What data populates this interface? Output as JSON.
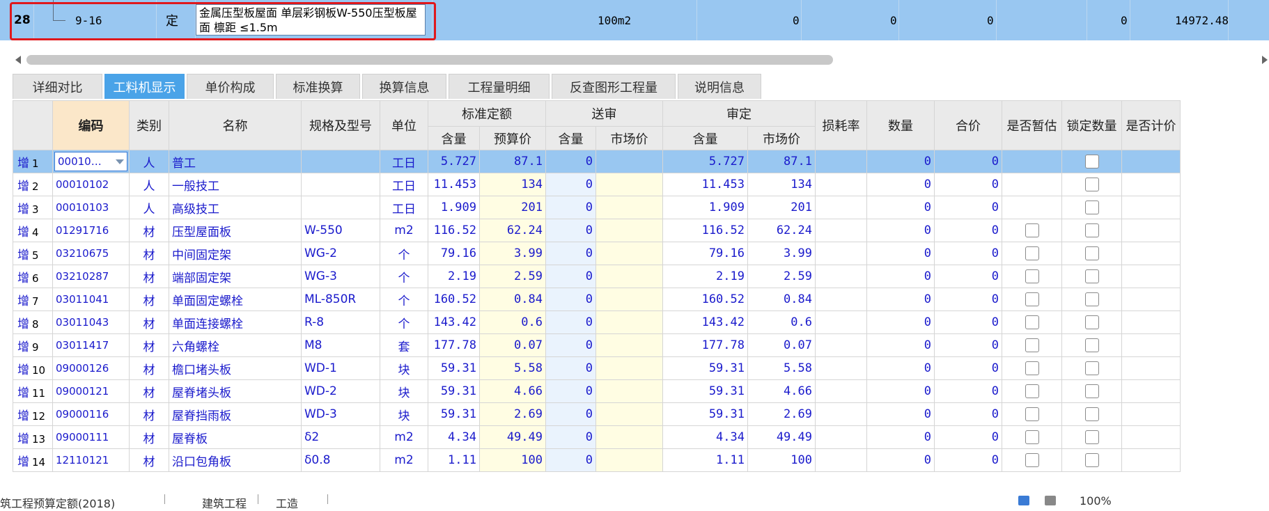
{
  "top_row": {
    "row_number": "28",
    "code": "9-16",
    "type": "定",
    "name": "金属压型板屋面 单层彩钢板W-550压型板屋面 檩距 ≤1.5m",
    "unit": "100m2",
    "v1": "0",
    "v2": "0",
    "v3": "0",
    "v4": "0",
    "total": "14972.48"
  },
  "tabs": [
    {
      "label": "详细对比",
      "active": false
    },
    {
      "label": "工料机显示",
      "active": true
    },
    {
      "label": "单价构成",
      "active": false
    },
    {
      "label": "标准换算",
      "active": false
    },
    {
      "label": "换算信息",
      "active": false
    },
    {
      "label": "工程量明细",
      "active": false
    },
    {
      "label": "反查图形工程量",
      "active": false
    },
    {
      "label": "说明信息",
      "active": false
    }
  ],
  "headers": {
    "code": "编码",
    "category": "类别",
    "name": "名称",
    "spec": "规格及型号",
    "unit": "单位",
    "std_quota": "标准定额",
    "submit": "送审",
    "approve": "审定",
    "sub_qty": "含量",
    "sub_budget_price": "预算价",
    "sub_market_price": "市场价",
    "loss_rate": "损耗率",
    "quantity": "数量",
    "total_price": "合价",
    "is_provisional": "是否暂估",
    "lock_qty": "锁定数量",
    "is_priced": "是否计价"
  },
  "rows": [
    {
      "add": "增",
      "n": "1",
      "code": "00010…",
      "cat": "人",
      "name": "普工",
      "spec": "",
      "unit": "工日",
      "std_qty": "5.727",
      "std_price": "87.1",
      "sub_qty": "0",
      "sub_price": "",
      "app_qty": "5.727",
      "app_price": "87.1",
      "loss": "",
      "qty": "0",
      "total": "0",
      "provisional": false,
      "lock": true
    },
    {
      "add": "增",
      "n": "2",
      "code": "00010102",
      "cat": "人",
      "name": "一般技工",
      "spec": "",
      "unit": "工日",
      "std_qty": "11.453",
      "std_price": "134",
      "sub_qty": "0",
      "sub_price": "",
      "app_qty": "11.453",
      "app_price": "134",
      "loss": "",
      "qty": "0",
      "total": "0",
      "provisional": false,
      "lock": true
    },
    {
      "add": "增",
      "n": "3",
      "code": "00010103",
      "cat": "人",
      "name": "高级技工",
      "spec": "",
      "unit": "工日",
      "std_qty": "1.909",
      "std_price": "201",
      "sub_qty": "0",
      "sub_price": "",
      "app_qty": "1.909",
      "app_price": "201",
      "loss": "",
      "qty": "0",
      "total": "0",
      "provisional": false,
      "lock": true
    },
    {
      "add": "增",
      "n": "4",
      "code": "01291716",
      "cat": "材",
      "name": "压型屋面板",
      "spec": "W-550",
      "unit": "m2",
      "std_qty": "116.52",
      "std_price": "62.24",
      "sub_qty": "0",
      "sub_price": "",
      "app_qty": "116.52",
      "app_price": "62.24",
      "loss": "",
      "qty": "0",
      "total": "0",
      "provisional": true,
      "lock": true
    },
    {
      "add": "增",
      "n": "5",
      "code": "03210675",
      "cat": "材",
      "name": "中间固定架",
      "spec": "WG-2",
      "unit": "个",
      "std_qty": "79.16",
      "std_price": "3.99",
      "sub_qty": "0",
      "sub_price": "",
      "app_qty": "79.16",
      "app_price": "3.99",
      "loss": "",
      "qty": "0",
      "total": "0",
      "provisional": true,
      "lock": true
    },
    {
      "add": "增",
      "n": "6",
      "code": "03210287",
      "cat": "材",
      "name": "端部固定架",
      "spec": "WG-3",
      "unit": "个",
      "std_qty": "2.19",
      "std_price": "2.59",
      "sub_qty": "0",
      "sub_price": "",
      "app_qty": "2.19",
      "app_price": "2.59",
      "loss": "",
      "qty": "0",
      "total": "0",
      "provisional": true,
      "lock": true
    },
    {
      "add": "增",
      "n": "7",
      "code": "03011041",
      "cat": "材",
      "name": "单面固定螺栓",
      "spec": "ML-850R",
      "unit": "个",
      "std_qty": "160.52",
      "std_price": "0.84",
      "sub_qty": "0",
      "sub_price": "",
      "app_qty": "160.52",
      "app_price": "0.84",
      "loss": "",
      "qty": "0",
      "total": "0",
      "provisional": true,
      "lock": true
    },
    {
      "add": "增",
      "n": "8",
      "code": "03011043",
      "cat": "材",
      "name": "单面连接螺栓",
      "spec": "R-8",
      "unit": "个",
      "std_qty": "143.42",
      "std_price": "0.6",
      "sub_qty": "0",
      "sub_price": "",
      "app_qty": "143.42",
      "app_price": "0.6",
      "loss": "",
      "qty": "0",
      "total": "0",
      "provisional": true,
      "lock": true
    },
    {
      "add": "增",
      "n": "9",
      "code": "03011417",
      "cat": "材",
      "name": "六角螺栓",
      "spec": "M8",
      "unit": "套",
      "std_qty": "177.78",
      "std_price": "0.07",
      "sub_qty": "0",
      "sub_price": "",
      "app_qty": "177.78",
      "app_price": "0.07",
      "loss": "",
      "qty": "0",
      "total": "0",
      "provisional": true,
      "lock": true
    },
    {
      "add": "增",
      "n": "10",
      "code": "09000126",
      "cat": "材",
      "name": "檐口堵头板",
      "spec": "WD-1",
      "unit": "块",
      "std_qty": "59.31",
      "std_price": "5.58",
      "sub_qty": "0",
      "sub_price": "",
      "app_qty": "59.31",
      "app_price": "5.58",
      "loss": "",
      "qty": "0",
      "total": "0",
      "provisional": true,
      "lock": true
    },
    {
      "add": "增",
      "n": "11",
      "code": "09000121",
      "cat": "材",
      "name": "屋脊堵头板",
      "spec": "WD-2",
      "unit": "块",
      "std_qty": "59.31",
      "std_price": "4.66",
      "sub_qty": "0",
      "sub_price": "",
      "app_qty": "59.31",
      "app_price": "4.66",
      "loss": "",
      "qty": "0",
      "total": "0",
      "provisional": true,
      "lock": true
    },
    {
      "add": "增",
      "n": "12",
      "code": "09000116",
      "cat": "材",
      "name": "屋脊挡雨板",
      "spec": "WD-3",
      "unit": "块",
      "std_qty": "59.31",
      "std_price": "2.69",
      "sub_qty": "0",
      "sub_price": "",
      "app_qty": "59.31",
      "app_price": "2.69",
      "loss": "",
      "qty": "0",
      "total": "0",
      "provisional": true,
      "lock": true
    },
    {
      "add": "增",
      "n": "13",
      "code": "09000111",
      "cat": "材",
      "name": "屋脊板",
      "spec": "δ2",
      "unit": "m2",
      "std_qty": "4.34",
      "std_price": "49.49",
      "sub_qty": "0",
      "sub_price": "",
      "app_qty": "4.34",
      "app_price": "49.49",
      "loss": "",
      "qty": "0",
      "total": "0",
      "provisional": true,
      "lock": true
    },
    {
      "add": "增",
      "n": "14",
      "code": "12110121",
      "cat": "材",
      "name": "沿口包角板",
      "spec": "δ0.8",
      "unit": "m2",
      "std_qty": "1.11",
      "std_price": "100",
      "sub_qty": "0",
      "sub_price": "",
      "app_qty": "1.11",
      "app_price": "100",
      "loss": "",
      "qty": "0",
      "total": "0",
      "provisional": true,
      "lock": true
    }
  ],
  "status_bar": {
    "item1": "筑工程预算定额(2018)",
    "item2": "建筑工程",
    "item3": "工造",
    "zoom": "100%"
  },
  "colors": {
    "selected_row": "#99c7f1",
    "active_tab": "#4aa3e8",
    "highlight_border": "#e0181c",
    "code_header": "#fbe7c9"
  }
}
